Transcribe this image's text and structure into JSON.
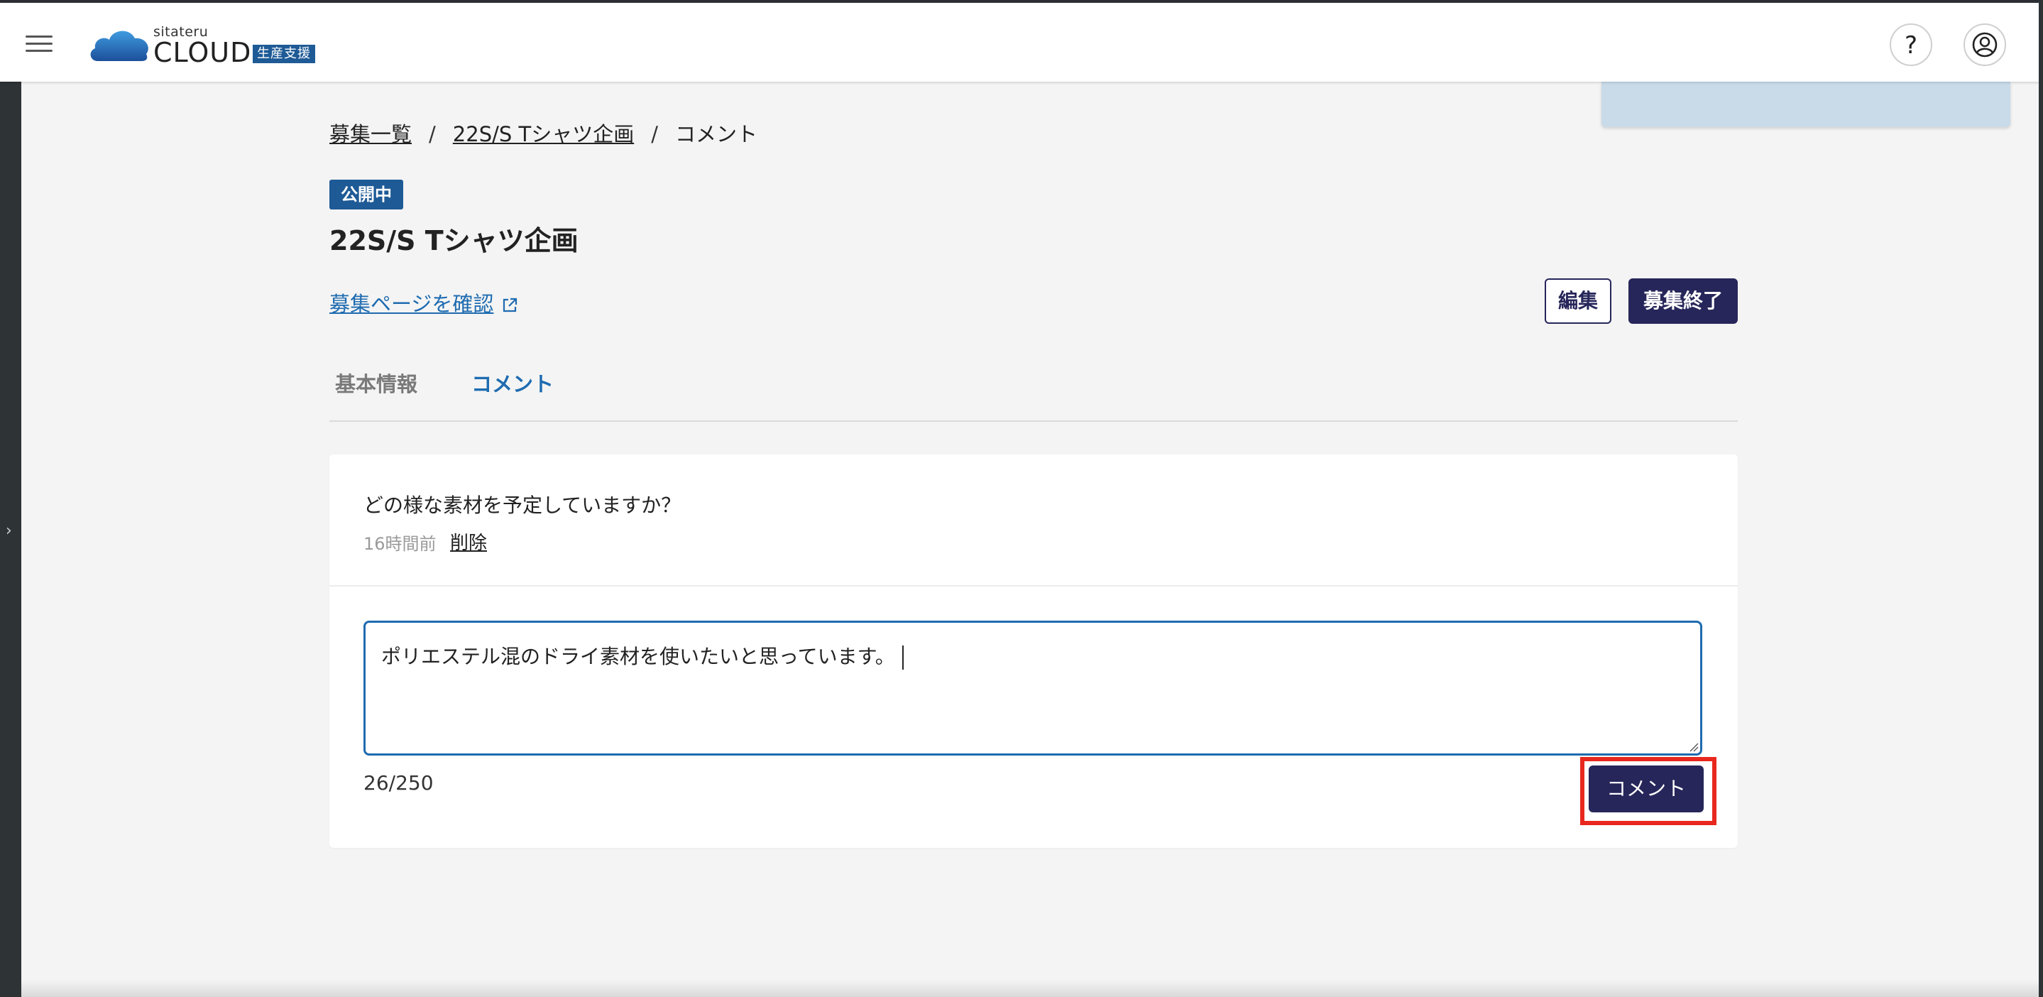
{
  "header": {
    "logo_small": "sitateru",
    "logo_big": "CLOUD",
    "logo_badge": "生産支援",
    "help_label": "?"
  },
  "breadcrumb": {
    "item1": "募集一覧",
    "item2": "22S/S Tシャツ企画",
    "item3": "コメント",
    "sep": "/"
  },
  "project": {
    "status": "公開中",
    "title": "22S/S Tシャツ企画",
    "recruit_link": "募集ページを確認"
  },
  "actions": {
    "edit": "編集",
    "end": "募集終了"
  },
  "tabs": {
    "basic": "基本情報",
    "comment": "コメント"
  },
  "comment": {
    "text": "どの様な素材を予定していますか？",
    "time": "16時間前",
    "delete": "削除"
  },
  "form": {
    "value": "ポリエステル混のドライ素材を使いたいと思っています。",
    "count": "26/250",
    "submit": "コメント"
  },
  "colors": {
    "primary": "#26265a",
    "accent": "#1e6bb0",
    "badge": "#1e5a96",
    "highlight": "#e8281e"
  }
}
